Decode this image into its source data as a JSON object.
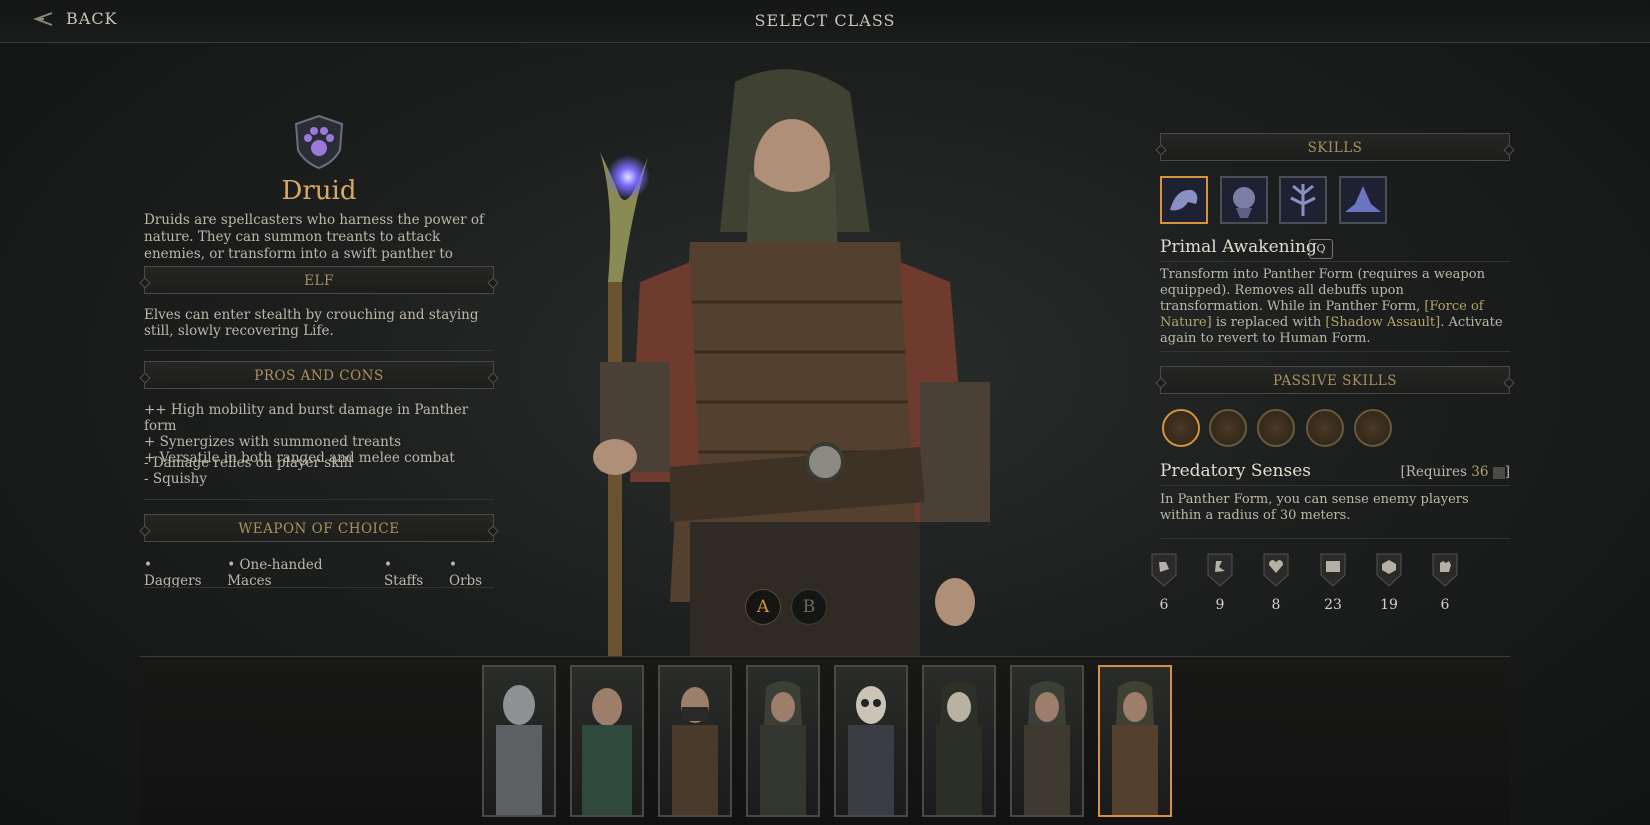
{
  "header": {
    "back_label": "BACK",
    "title": "SELECT CLASS"
  },
  "class_info": {
    "name": "Druid",
    "description": "Druids are spellcasters who harness the power of nature. They can summon treants to attack enemies, or transform into a swift panther to pursue foes or",
    "race_header": "ELF",
    "race_description": "Elves can enter stealth by crouching and staying still, slowly recovering Life.",
    "pros_cons_header": "PROS AND CONS",
    "pros": [
      "++ High mobility and burst damage in Panther form",
      "+ Synergizes with summoned treants",
      "+ Versatile in both ranged and melee combat"
    ],
    "cons": [
      "- Damage relies on player skill",
      "- Squishy"
    ],
    "weapon_header": "WEAPON OF CHOICE",
    "weapons": [
      "• Daggers",
      "• One-handed Maces",
      "• Staffs",
      "• Orbs"
    ]
  },
  "skills": {
    "header": "SKILLS",
    "icons": [
      "panther-skill-icon",
      "treant-skill-icon",
      "force-of-nature-icon",
      "shadow-assault-icon"
    ],
    "selected_name": "Primal Awakening",
    "selected_key": "Q",
    "selected_desc_parts": [
      "Transform into Panther Form (requires a weapon equipped). Removes all debuffs upon transformation. While in Panther Form, ",
      "[Force of Nature]",
      " is replaced with ",
      "[Shadow Assault]",
      ". Activate again to revert to Human Form."
    ]
  },
  "passives": {
    "header": "PASSIVE SKILLS",
    "icons": [
      "wolf-passive-icon",
      "claw-passive-icon",
      "eye-passive-icon",
      "leaf-passive-icon",
      "swirl-passive-icon"
    ],
    "selected_name": "Predatory Senses",
    "requires_prefix": "[Requires",
    "requires_value": "36",
    "requires_suffix": "]",
    "selected_desc": "In Panther Form, you can sense enemy players within a radius of 30 meters."
  },
  "stats": [
    {
      "icon": "strength-icon",
      "value": "6"
    },
    {
      "icon": "agility-icon",
      "value": "9"
    },
    {
      "icon": "vigor-icon",
      "value": "8"
    },
    {
      "icon": "knowledge-icon",
      "value": "23"
    },
    {
      "icon": "will-icon",
      "value": "19"
    },
    {
      "icon": "resourcefulness-icon",
      "value": "6"
    }
  ],
  "variants": {
    "a": "A",
    "b": "B",
    "selected": "A"
  },
  "class_portraits": [
    "fighter-portrait",
    "barbarian-portrait",
    "rogue-portrait",
    "ranger-portrait",
    "wizard-portrait",
    "cleric-portrait",
    "bard-portrait",
    "druid-portrait"
  ],
  "colors": {
    "accent": "#d8923f",
    "class_name": "#d9a865",
    "header_text": "#a8915e",
    "highlight_text": "#b9a26a"
  }
}
